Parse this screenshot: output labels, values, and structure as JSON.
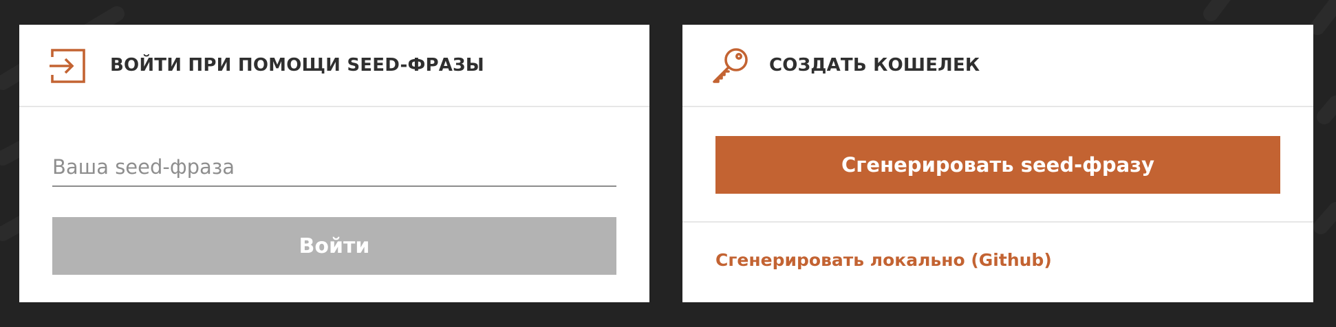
{
  "colors": {
    "background": "#232323",
    "card": "#ffffff",
    "accent": "#c36332",
    "disabled_button": "#b3b3b3",
    "title_text": "#2f2f2f",
    "divider": "#e6e6e6"
  },
  "login_card": {
    "icon": "login-arrow-icon",
    "title": "ВОЙТИ ПРИ ПОМОЩИ SEED-ФРАЗЫ",
    "seed_input": {
      "value": "",
      "placeholder": "Ваша seed-фраза"
    },
    "submit_label": "Войти"
  },
  "create_card": {
    "icon": "key-icon",
    "title": "СОЗДАТЬ КОШЕЛЕК",
    "generate_label": "Сгенерировать seed-фразу",
    "local_link_label": "Сгенерировать локально (Github)"
  }
}
